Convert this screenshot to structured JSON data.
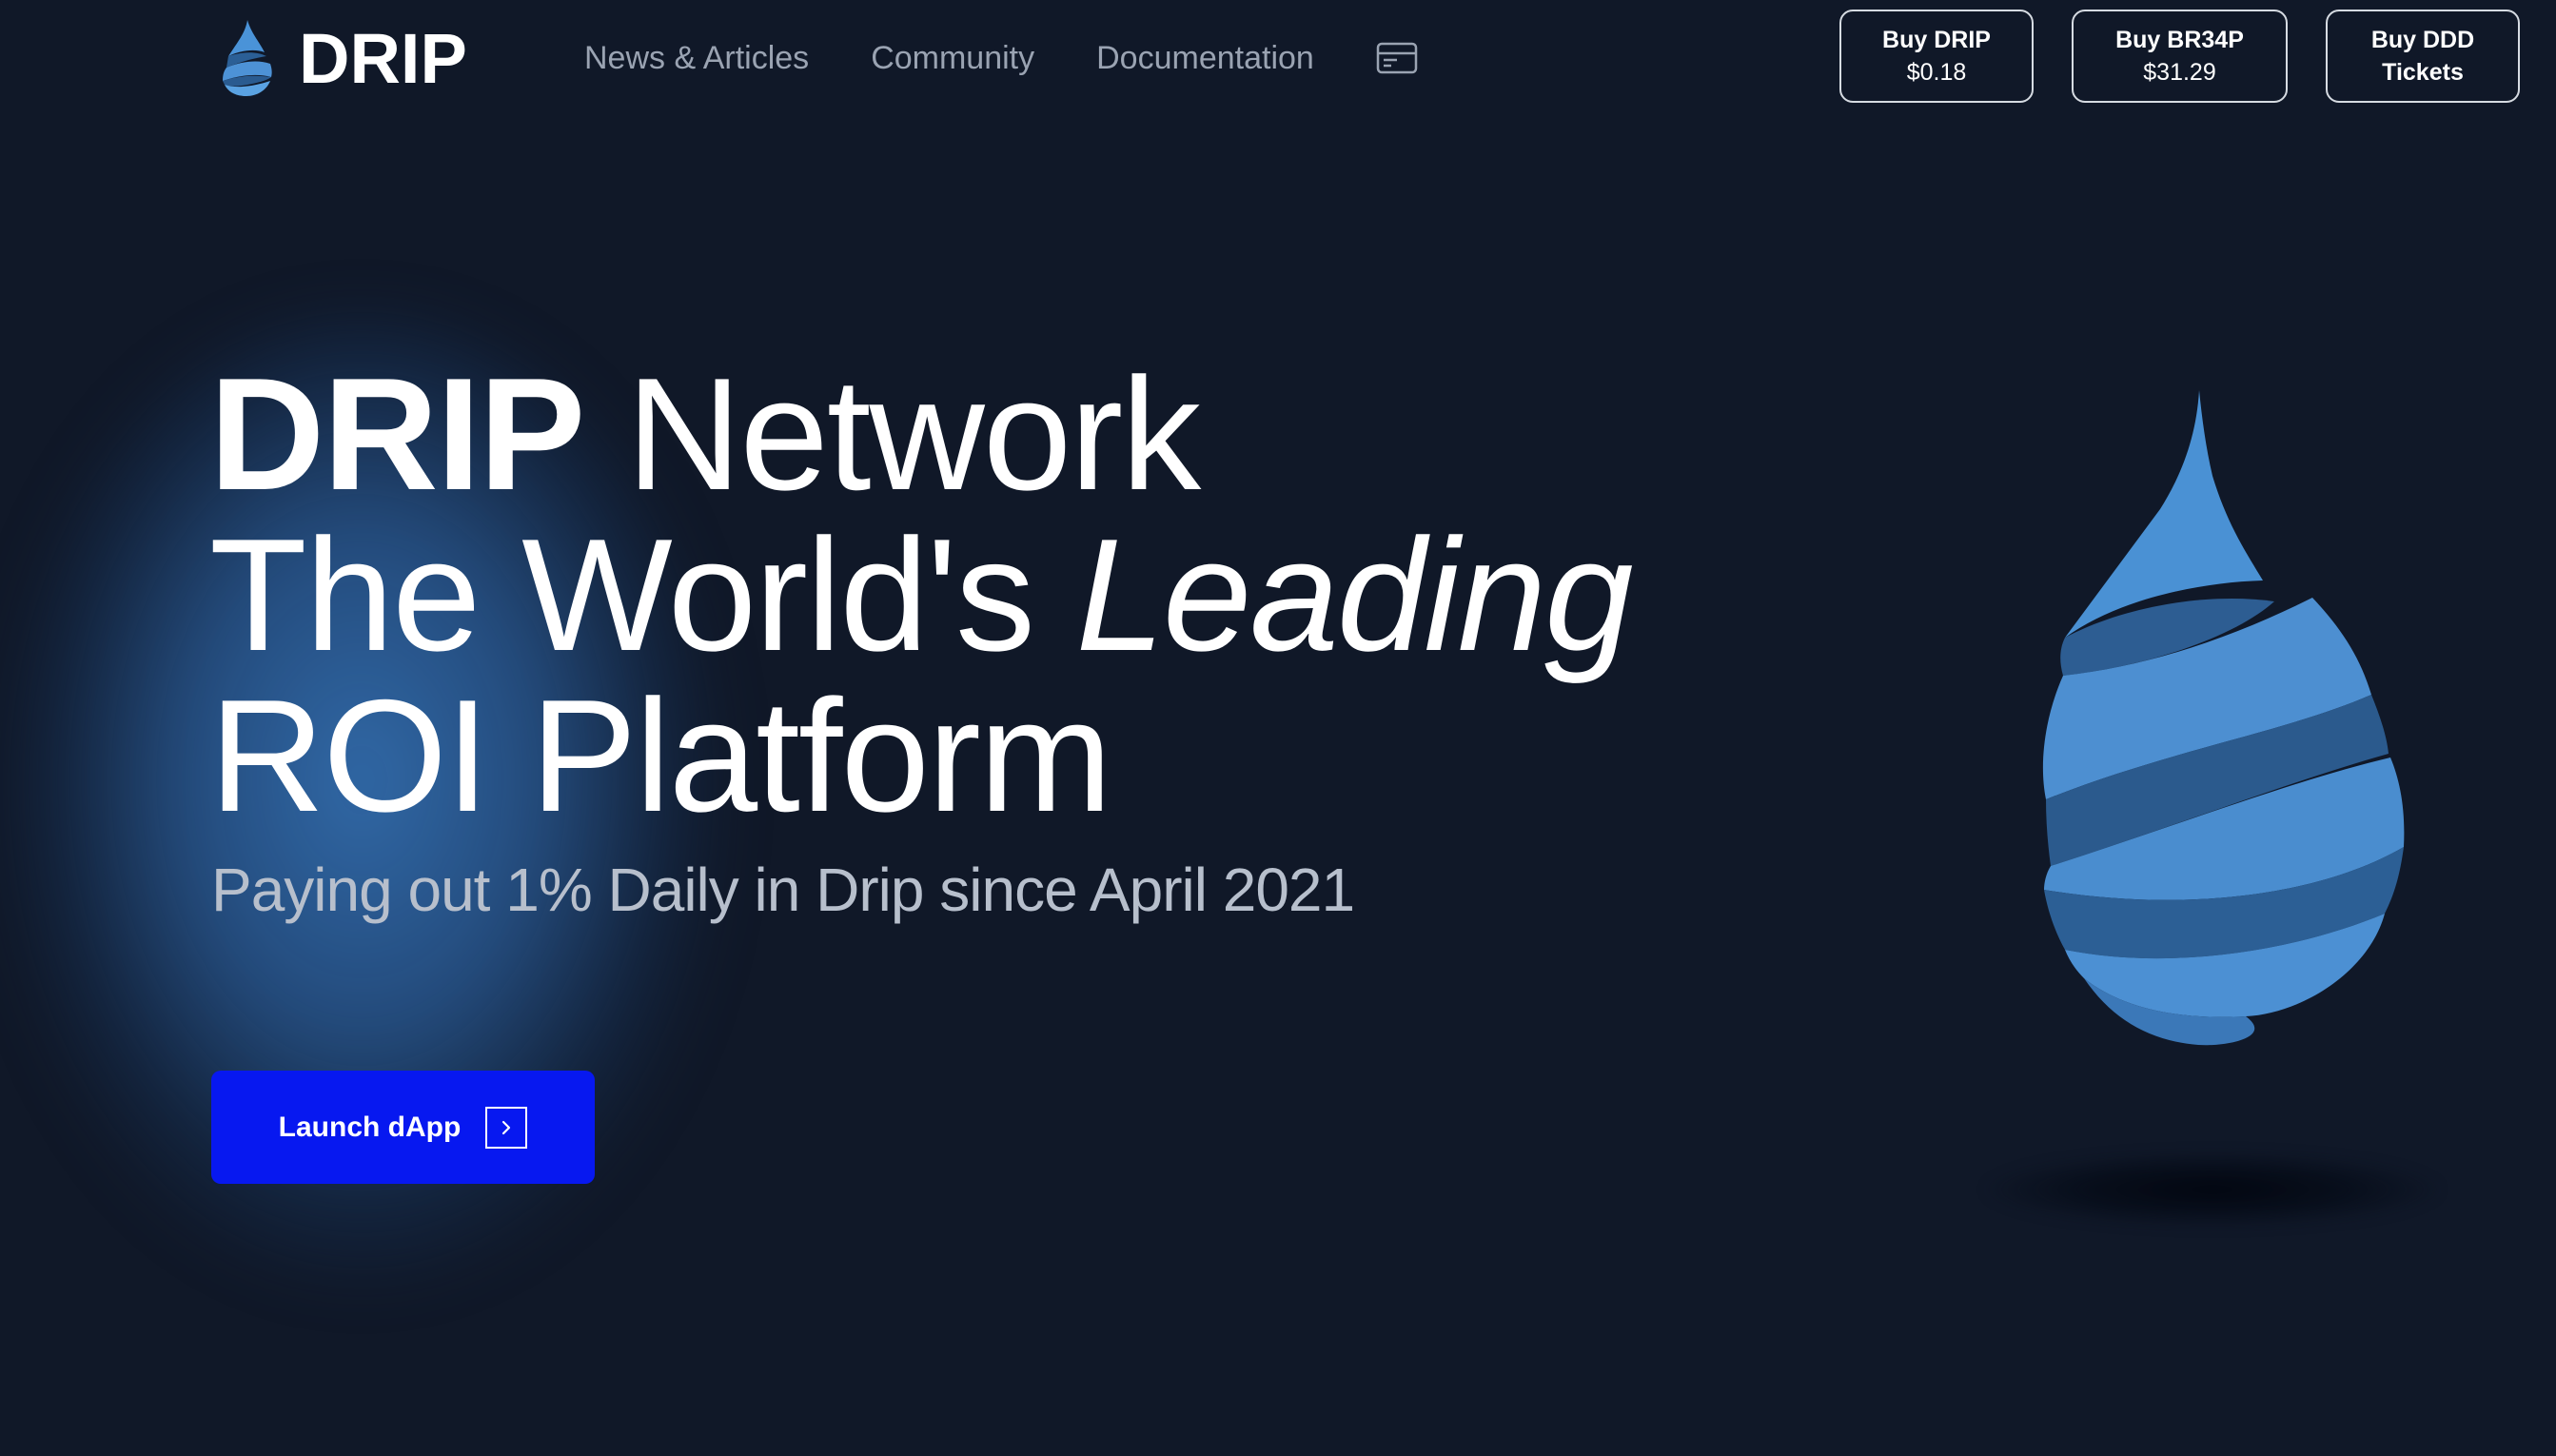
{
  "brand": {
    "name": "DRIP",
    "logo_icon": "spiral-drop-icon"
  },
  "nav": {
    "links": [
      "News & Articles",
      "Community",
      "Documentation"
    ],
    "card_icon": "card-icon"
  },
  "buy_buttons": [
    {
      "line1": "Buy DRIP",
      "line2": "$0.18"
    },
    {
      "line1": "Buy BR34P",
      "line2": "$31.29"
    },
    {
      "line1": "Buy DDD",
      "line2": "Tickets"
    }
  ],
  "hero": {
    "line1_bold": "DRIP",
    "line1_rest": "Network",
    "line2_regular": "The World's",
    "line2_italic": "Leading",
    "line3": "ROI Platform",
    "subtitle": "Paying out 1% Daily in Drip since April 2021",
    "cta_label": "Launch dApp",
    "cta_icon": "chevron-right-icon"
  },
  "colors": {
    "background": "#101828",
    "cta": "#0718f0",
    "drop_blue": "#4d8fd1",
    "drop_dark": "#2c5f95",
    "nav_text": "#9aa3b2"
  }
}
